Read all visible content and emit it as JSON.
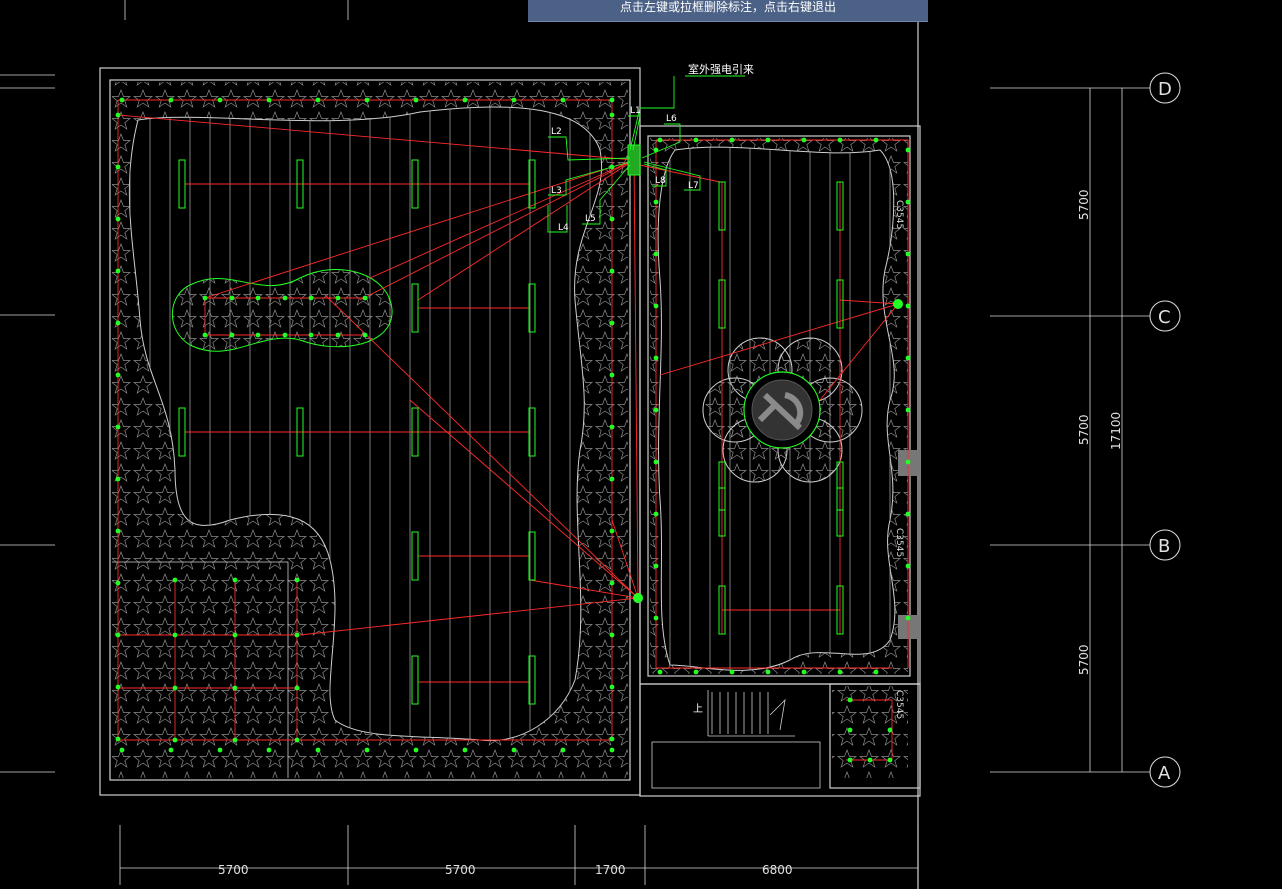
{
  "tooltip": {
    "text": "点击左键或拉框删除标注，点击右键退出"
  },
  "labels": {
    "source": "室外强电引来",
    "circuits": [
      "L1",
      "L2",
      "L3",
      "L4",
      "L5",
      "L6",
      "L7",
      "L8"
    ],
    "axes": [
      "D",
      "C",
      "B",
      "A"
    ],
    "dims_bottom": [
      "5700",
      "5700",
      "1700",
      "6800"
    ],
    "dims_right": [
      "5700",
      "5700",
      "5700"
    ],
    "dim_total": "17100",
    "cable_tag": "C3545",
    "stair_up": "上"
  },
  "colors": {
    "background": "#000000",
    "wall": "#cfcfcf",
    "hatch": "#8a8a8a",
    "wire": "#ff2a2a",
    "fixture": "#22ff22",
    "dimension": "#e0e0e0",
    "tooltip_bg": "#4b6186"
  }
}
